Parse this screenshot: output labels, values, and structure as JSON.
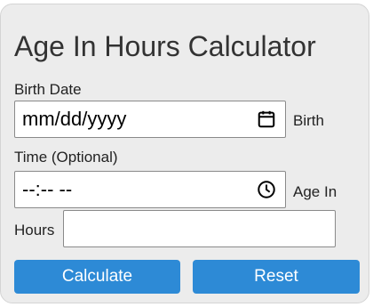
{
  "form": {
    "title": "Age In Hours Calculator",
    "birth_date_label": "Birth Date",
    "birth_date_value": "mm/dd/yyyy",
    "birth_suffix": "Birth",
    "time_label": "Time (Optional)",
    "time_value": "--:-- --",
    "age_in_label": "Age In",
    "hours_label": "Hours",
    "hours_value": "",
    "calculate_label": "Calculate",
    "reset_label": "Reset"
  },
  "colors": {
    "button": "#2d8ad6",
    "card": "#ececec"
  },
  "icons": {
    "date": "calendar-icon",
    "time": "clock-icon"
  }
}
